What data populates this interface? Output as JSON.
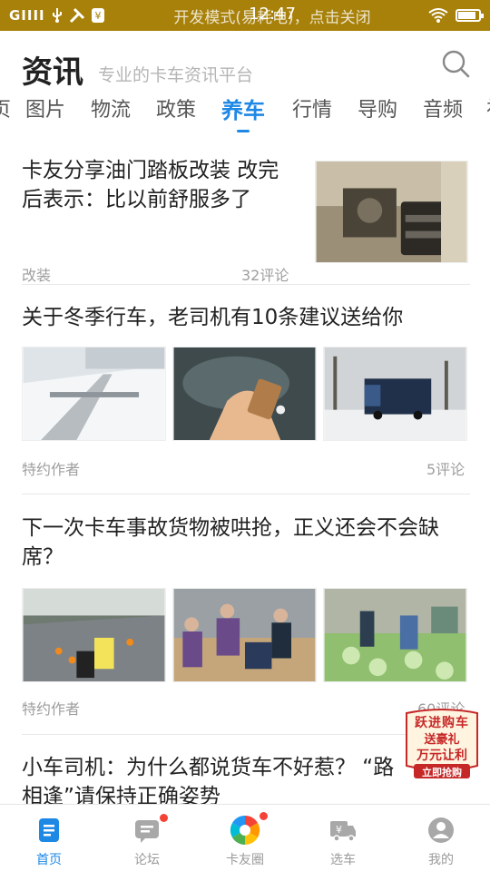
{
  "status_bar": {
    "signal": "GIIII",
    "time": "12:47",
    "notice": "开发模式(易耗电)，点击关闭"
  },
  "header": {
    "title": "资讯",
    "slogan": "专业的卡车资讯平台"
  },
  "tabs": [
    {
      "label": "页"
    },
    {
      "label": "图片"
    },
    {
      "label": "物流"
    },
    {
      "label": "政策"
    },
    {
      "label": "养车"
    },
    {
      "label": "行情"
    },
    {
      "label": "导购"
    },
    {
      "label": "音频"
    },
    {
      "label": "视"
    }
  ],
  "active_tab": "养车",
  "articles": [
    {
      "title": "卡友分享油门踏板改装 改完后表示：比以前舒服多了",
      "source": "改装",
      "comments": "32评论"
    },
    {
      "title": "关于冬季行车，老司机有10条建议送给你",
      "source": "特约作者",
      "comments": "5评论"
    },
    {
      "title": "下一次卡车事故货物被哄抢，正义还会不会缺席？",
      "source": "特约作者",
      "comments": "60评论"
    },
    {
      "title": "小车司机：为什么都说货车不好惹？ “路相逢”请保持正确姿势"
    }
  ],
  "promo": {
    "line1": "跃进购车",
    "line2": "送豪礼",
    "line3": "万元让利",
    "button": "立即抢购"
  },
  "bottom_nav": [
    {
      "label": "首页"
    },
    {
      "label": "论坛"
    },
    {
      "label": "卡友圈"
    },
    {
      "label": "选车"
    },
    {
      "label": "我的"
    }
  ],
  "colors": {
    "accent": "#1e88e5",
    "status_bar": "#a8810a",
    "badge_red": "#f44336",
    "promo_red": "#c62828"
  }
}
